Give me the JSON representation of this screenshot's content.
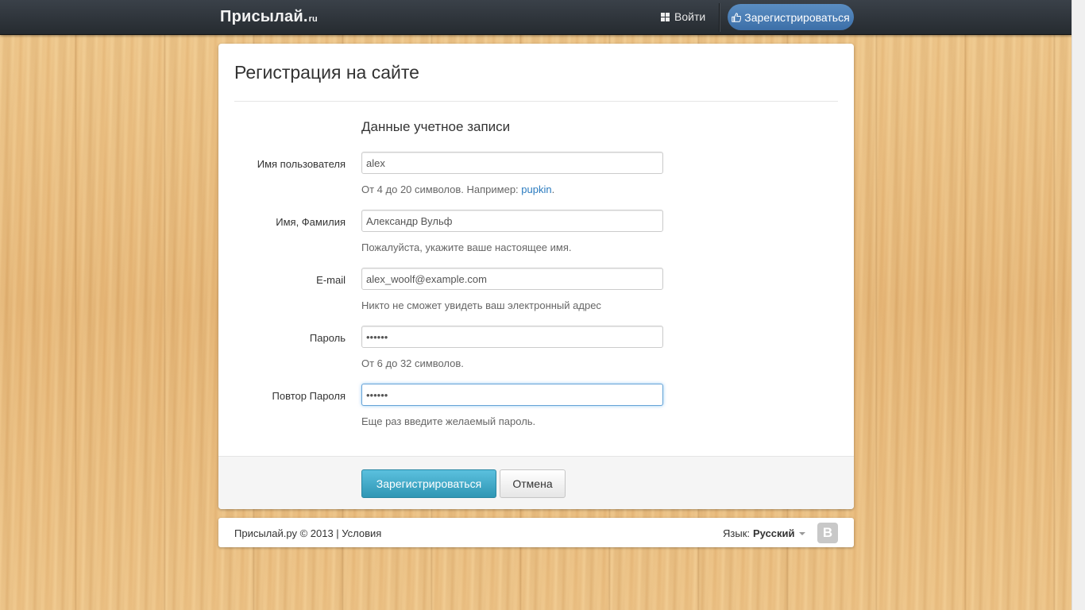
{
  "header": {
    "brand_name": "Присылай.",
    "brand_tld": "ru",
    "login_label": "Войти",
    "register_label": "Зарегистрироваться"
  },
  "page": {
    "title": "Регистрация на сайте",
    "section_legend": "Данные учетное записи"
  },
  "form": {
    "username": {
      "label": "Имя пользователя",
      "value": "alex",
      "help_prefix": "От 4 до 20 символов. Например: ",
      "help_link": "pupkin",
      "help_suffix": "."
    },
    "fullname": {
      "label": "Имя, Фамилия",
      "value": "Александр Вульф",
      "help": "Пожалуйста, укажите ваше настоящее имя."
    },
    "email": {
      "label": "E-mail",
      "value": "alex_woolf@example.com",
      "help": "Никто не сможет увидеть ваш электронный адрес"
    },
    "password": {
      "label": "Пароль",
      "value": "••••••",
      "help": "От 6 до 32 символов."
    },
    "password_repeat": {
      "label": "Повтор Пароля",
      "value": "••••••",
      "help": "Еще раз введите желаемый пароль."
    }
  },
  "actions": {
    "submit_label": "Зарегистрироваться",
    "cancel_label": "Отмена"
  },
  "footer": {
    "copyright": "Присылай.ру © 2013 | ",
    "terms_label": "Условия",
    "lang_label": "Язык:",
    "lang_value": "Русский",
    "social_letter": "B"
  },
  "colors": {
    "primary_button": "#2f96b4",
    "header_register_button": "#3c6fa8",
    "topbar": "#2b3036",
    "link": "#2a7bbf"
  },
  "icons": {
    "login": "grid-icon",
    "register": "thumbs-up-icon",
    "social": "vk-icon",
    "lang": "caret-down-icon"
  }
}
